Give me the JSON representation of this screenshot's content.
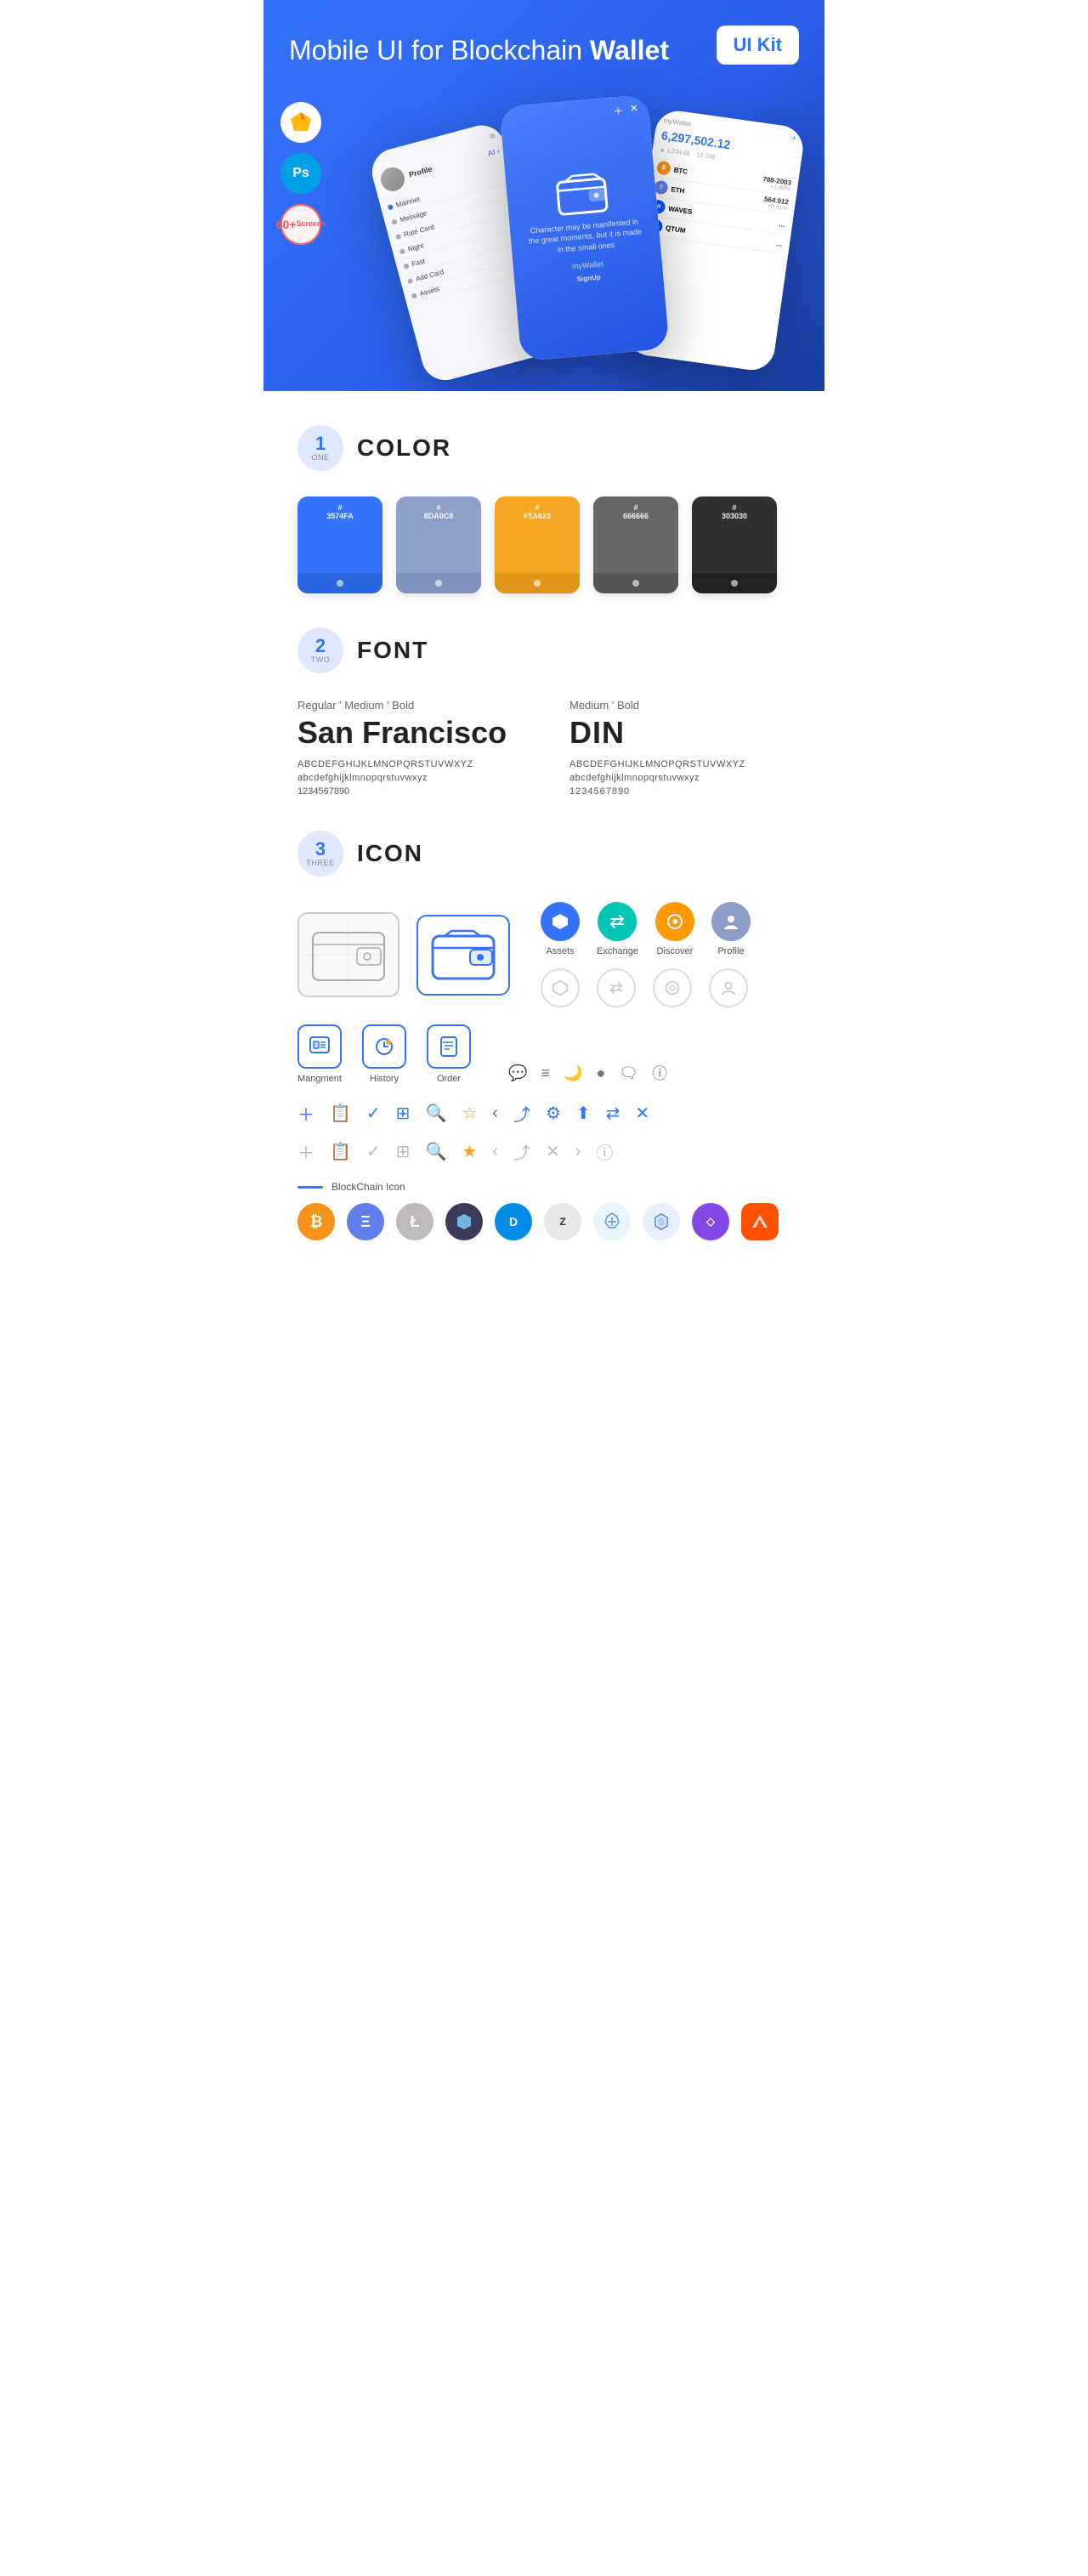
{
  "hero": {
    "title_normal": "Mobile UI for Blockchain ",
    "title_bold": "Wallet",
    "badge": "UI Kit",
    "sketch_label": "Sketch",
    "ps_label": "Ps",
    "screens_label": "60+\nScreens"
  },
  "sections": {
    "color": {
      "number": "1",
      "sub": "ONE",
      "title": "COLOR",
      "swatches": [
        {
          "hex": "#3574FA",
          "label": "#\n3574FA"
        },
        {
          "hex": "#8D A0C8",
          "label": "#\n8DA0C8"
        },
        {
          "hex": "#F5A623",
          "label": "#\nF5A623"
        },
        {
          "hex": "#666666",
          "label": "#\n666666"
        },
        {
          "hex": "#303030",
          "label": "#\n303030"
        }
      ]
    },
    "font": {
      "number": "2",
      "sub": "TWO",
      "title": "FONT",
      "font1": {
        "styles": "Regular ' Medium ' Bold",
        "name": "San Francisco",
        "uppercase": "ABCDEFGHIJKLMNOPQRSTUVWXYZ",
        "lowercase": "abcdefghijklmnopqrstuvwxyz",
        "numbers": "1234567890"
      },
      "font2": {
        "styles": "Medium ' Bold",
        "name": "DIN",
        "uppercase": "ABCDEFGHIJKLMNOPQRSTUVWXYZ",
        "lowercase": "abcdefghijklmnopqrstuvwxyz",
        "numbers": "1234567890"
      }
    },
    "icon": {
      "number": "3",
      "sub": "THREE",
      "title": "ICON",
      "nav_icons": [
        {
          "label": "Assets"
        },
        {
          "label": "Exchange"
        },
        {
          "label": "Discover"
        },
        {
          "label": "Profile"
        }
      ],
      "bottom_nav": [
        {
          "label": "Mangment"
        },
        {
          "label": "History"
        },
        {
          "label": "Order"
        }
      ],
      "blockchain_label": "BlockChain Icon",
      "crypto_coins": [
        "BTC",
        "ETH",
        "LTC",
        "DASH",
        "ZCASH",
        "WAVES",
        "STRAT",
        "ARK",
        "MATIC",
        "BAT"
      ]
    }
  }
}
